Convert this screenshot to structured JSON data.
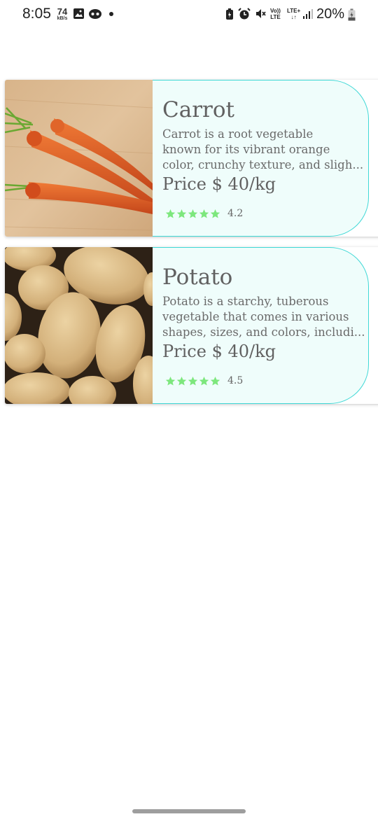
{
  "status_bar": {
    "time": "8:05",
    "net_speed": "74",
    "net_unit": "kB/s",
    "volte_line1": "Vo))",
    "volte_line2": "LTE",
    "lte_line1": "LTE+",
    "lte_line2": "↓↑",
    "battery": "20%",
    "icons": [
      "gallery-icon",
      "assistant-icon",
      "notification-dot",
      "battery-saver-icon",
      "alarm-icon",
      "mute-icon",
      "signal-icon",
      "battery-icon"
    ]
  },
  "products": [
    {
      "name": "Carrot",
      "description_lines": [
        "Carrot is a root vegetable",
        "known for its vibrant orange",
        "color, crunchy texture, and sligh..."
      ],
      "price": "Price $ 40/kg",
      "rating": "4.2",
      "stars": 5
    },
    {
      "name": "Potato",
      "description_lines": [
        "Potato is a starchy, tuberous",
        "vegetable that comes in various",
        "shapes, sizes, and colors, includi..."
      ],
      "price": "Price $ 40/kg",
      "rating": "4.5",
      "stars": 5
    }
  ],
  "colors": {
    "card_border": "#3fd8d6",
    "card_panel": "#effdfb",
    "star": "#7de77d"
  }
}
